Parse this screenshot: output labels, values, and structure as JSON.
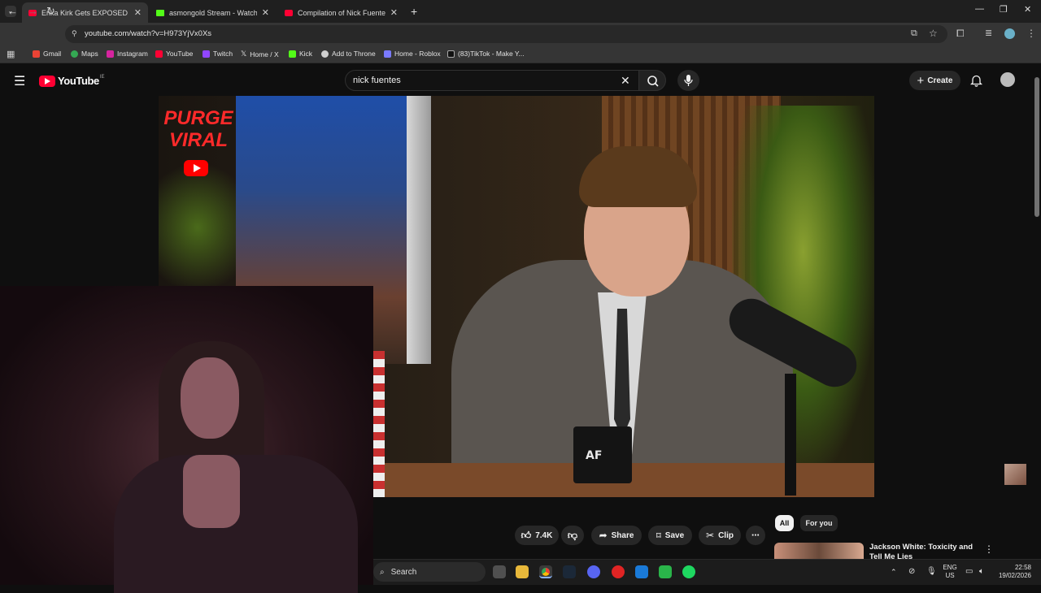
{
  "browser": {
    "tabs": [
      {
        "title": "Erika Kirk Gets EXPOSED by Nic",
        "active": true,
        "favicon": "youtube-icon"
      },
      {
        "title": "asmongold Stream - Watch Live",
        "active": false,
        "favicon": "kick-icon"
      },
      {
        "title": "Compilation of Nick Fuentes p",
        "active": false,
        "favicon": "youtube-icon"
      }
    ],
    "url": "youtube.com/watch?v=H973YjVx0Xs",
    "bookmarks": [
      "Gmail",
      "Maps",
      "Instagram",
      "YouTube",
      "Twitch",
      "Home / X",
      "Kick",
      "Add to Throne",
      "Home - Roblox",
      "(83)TikTok - Make Y..."
    ]
  },
  "youtube": {
    "logo_text": "YouTube",
    "logo_region": "IE",
    "search_value": "nick fuentes",
    "create_label": "Create"
  },
  "video_overlay": {
    "purge_line1": "PURGE",
    "purge_line2": "VIRAL",
    "mug_text": "AF"
  },
  "actions": {
    "likes": "7.4K",
    "share": "Share",
    "save": "Save",
    "clip": "Clip"
  },
  "chips": {
    "all": "All",
    "for_you": "For you"
  },
  "recommendation": {
    "title": "Jackson White: Toxicity and Tell Me Lies"
  },
  "taskbar": {
    "search_label": "Search",
    "lang_top": "ENG",
    "lang_bottom": "US",
    "time": "22:58",
    "date": "19/02/2026"
  },
  "colors": {
    "youtube_red": "#ff0033",
    "kick_green": "#53fc18",
    "bg": "#0f0f0f"
  }
}
